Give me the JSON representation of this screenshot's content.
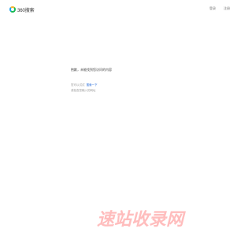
{
  "header": {
    "logo_text": "360搜索",
    "nav": [
      {
        "label": "登录"
      },
      {
        "label": "注册"
      }
    ]
  },
  "main": {
    "message": "抱歉，未能找到您访问的内容",
    "suggestion_prefix": "您可以试试",
    "suggestion_link": "搜索一下",
    "suggestion_line2": "或检查您输入的网址"
  },
  "watermark": {
    "text": "速站收录网"
  },
  "colors": {
    "link": "#1a63d8",
    "logo_green": "#19b955",
    "watermark": "#ffadad"
  }
}
